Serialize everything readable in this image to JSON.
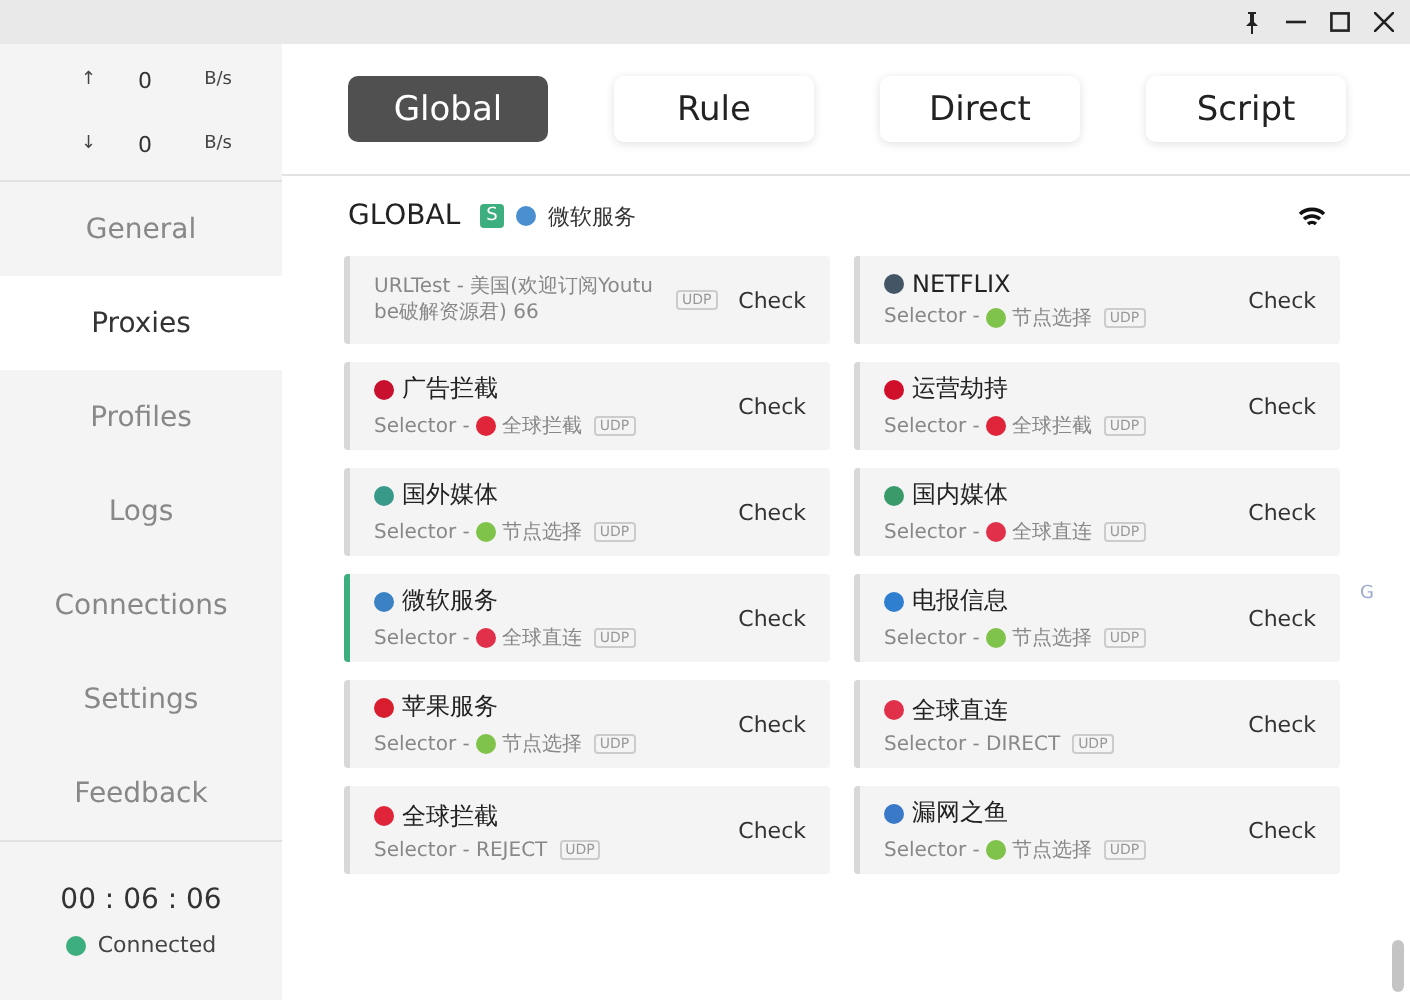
{
  "speed": [
    {
      "arrow": "↑",
      "value": "0",
      "unit": "B/s"
    },
    {
      "arrow": "↓",
      "value": "0",
      "unit": "B/s"
    }
  ],
  "sidebar": {
    "items": [
      {
        "label": "General",
        "selected": false
      },
      {
        "label": "Proxies",
        "selected": true
      },
      {
        "label": "Profiles",
        "selected": false
      },
      {
        "label": "Logs",
        "selected": false
      },
      {
        "label": "Connections",
        "selected": false
      },
      {
        "label": "Settings",
        "selected": false
      },
      {
        "label": "Feedback",
        "selected": false
      }
    ]
  },
  "timer": "00 : 06 : 06",
  "status": {
    "label": "Connected",
    "color": "#3dae7d"
  },
  "modes": [
    {
      "label": "Global",
      "selected": true
    },
    {
      "label": "Rule",
      "selected": false
    },
    {
      "label": "Direct",
      "selected": false
    },
    {
      "label": "Script",
      "selected": false
    }
  ],
  "group": {
    "title": "GLOBAL",
    "badge": "S",
    "now": {
      "label": "微软服务",
      "color": "#4a8fcf"
    }
  },
  "proxies": [
    {
      "type": "URLTest - 美国(欢迎订阅Youtube破解资源君) 66",
      "udp": "UDP",
      "action": "Check",
      "selected": false
    },
    {
      "name": "NETFLIX",
      "color": "#445566",
      "type": "Selector - ",
      "now": {
        "label": "节点选择",
        "color": "#7fc34a"
      },
      "udp": "UDP",
      "action": "Check",
      "selected": false
    },
    {
      "name": "广告拦截",
      "color": "#c8102e",
      "type": "Selector - ",
      "now": {
        "label": "全球拦截",
        "color": "#e0243a"
      },
      "udp": "UDP",
      "action": "Check",
      "selected": false
    },
    {
      "name": "运营劫持",
      "color": "#d0102a",
      "type": "Selector - ",
      "now": {
        "label": "全球拦截",
        "color": "#e0243a"
      },
      "udp": "UDP",
      "action": "Check",
      "selected": false
    },
    {
      "name": "国外媒体",
      "color": "#3a9a8a",
      "type": "Selector - ",
      "now": {
        "label": "节点选择",
        "color": "#7fc34a"
      },
      "udp": "UDP",
      "action": "Check",
      "selected": false
    },
    {
      "name": "国内媒体",
      "color": "#3a9a6a",
      "type": "Selector - ",
      "now": {
        "label": "全球直连",
        "color": "#e0304a"
      },
      "udp": "UDP",
      "action": "Check",
      "selected": false
    },
    {
      "name": "微软服务",
      "color": "#3b82c4",
      "type": "Selector - ",
      "now": {
        "label": "全球直连",
        "color": "#e0304a"
      },
      "udp": "UDP",
      "action": "Check",
      "selected": true
    },
    {
      "name": "电报信息",
      "color": "#2f7fd0",
      "type": "Selector - ",
      "now": {
        "label": "节点选择",
        "color": "#7fc34a"
      },
      "udp": "UDP",
      "action": "Check",
      "selected": false
    },
    {
      "name": "苹果服务",
      "color": "#d81e2e",
      "type": "Selector - ",
      "now": {
        "label": "节点选择",
        "color": "#7fc34a"
      },
      "udp": "UDP",
      "action": "Check",
      "selected": false
    },
    {
      "name": "全球直连",
      "color": "#e0304a",
      "type": "Selector - DIRECT",
      "udp": "UDP",
      "action": "Check",
      "selected": false
    },
    {
      "name": "全球拦截",
      "color": "#e0243a",
      "type": "Selector - REJECT",
      "udp": "UDP",
      "action": "Check",
      "selected": false
    },
    {
      "name": "漏网之鱼",
      "color": "#3a78c8",
      "type": "Selector - ",
      "now": {
        "label": "节点选择",
        "color": "#7fc34a"
      },
      "udp": "UDP",
      "action": "Check",
      "selected": false
    }
  ],
  "floating_hint": "G"
}
